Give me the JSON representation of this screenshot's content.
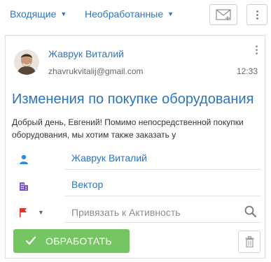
{
  "header": {
    "filter_folder": "Входящие",
    "filter_status": "Необработанные"
  },
  "message": {
    "sender_name": "Жаврук Виталий",
    "sender_email": "zhavrukvitalij@gmail.com",
    "time": "12:33",
    "subject": "Изменения по покупке оборудования",
    "body": "Добрый день, Евгений! Помимо непосредственной покупки оборудования, мы хотим также заказать у"
  },
  "links": {
    "contact": "Жаврук Виталий",
    "account": "Вектор",
    "activity_placeholder": "Привязать к Активность"
  },
  "actions": {
    "process_label": "ОБРАБОТАТЬ"
  },
  "colors": {
    "link": "#2c74c0",
    "process_button": "#76c563",
    "flag": "#e0322c",
    "contact_icon": "#2a8ee0",
    "account_icon": "#7a55c4"
  },
  "icons": {
    "mail": "mail-icon",
    "more": "more-vertical-icon",
    "contact": "contact-icon",
    "account": "account-icon",
    "flag": "flag-icon",
    "search": "search-icon",
    "check": "check-icon",
    "trash": "trash-icon"
  }
}
